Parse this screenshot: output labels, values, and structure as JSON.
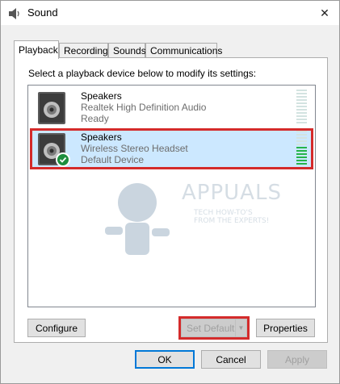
{
  "window": {
    "title": "Sound",
    "close_glyph": "✕"
  },
  "tabs": [
    {
      "label": "Playback",
      "active": true
    },
    {
      "label": "Recording",
      "active": false
    },
    {
      "label": "Sounds",
      "active": false
    },
    {
      "label": "Communications",
      "active": false
    }
  ],
  "panel": {
    "instruction": "Select a playback device below to modify its settings:"
  },
  "devices": [
    {
      "name": "Speakers",
      "description": "Realtek High Definition Audio",
      "status": "Ready",
      "selected": false,
      "icon": "speaker-icon",
      "level": 0.0
    },
    {
      "name": "Speakers",
      "description": "Wireless Stereo Headset",
      "status": "Default Device",
      "selected": true,
      "icon": "speaker-icon",
      "badge": "default-check-icon",
      "level": 0.55
    }
  ],
  "watermark": {
    "brand": "APPUALS",
    "tagline": "TECH HOW-TO'S FROM THE EXPERTS!"
  },
  "buttons": {
    "configure": "Configure",
    "set_default": "Set Default",
    "properties": "Properties",
    "ok": "OK",
    "cancel": "Cancel",
    "apply": "Apply"
  },
  "colors": {
    "selection": "#cce8ff",
    "highlight_annotation": "#d42b2b",
    "meter_active": "#26b44a",
    "meter_idle": "#d3e3e1",
    "default_badge": "#1e8e3e"
  }
}
